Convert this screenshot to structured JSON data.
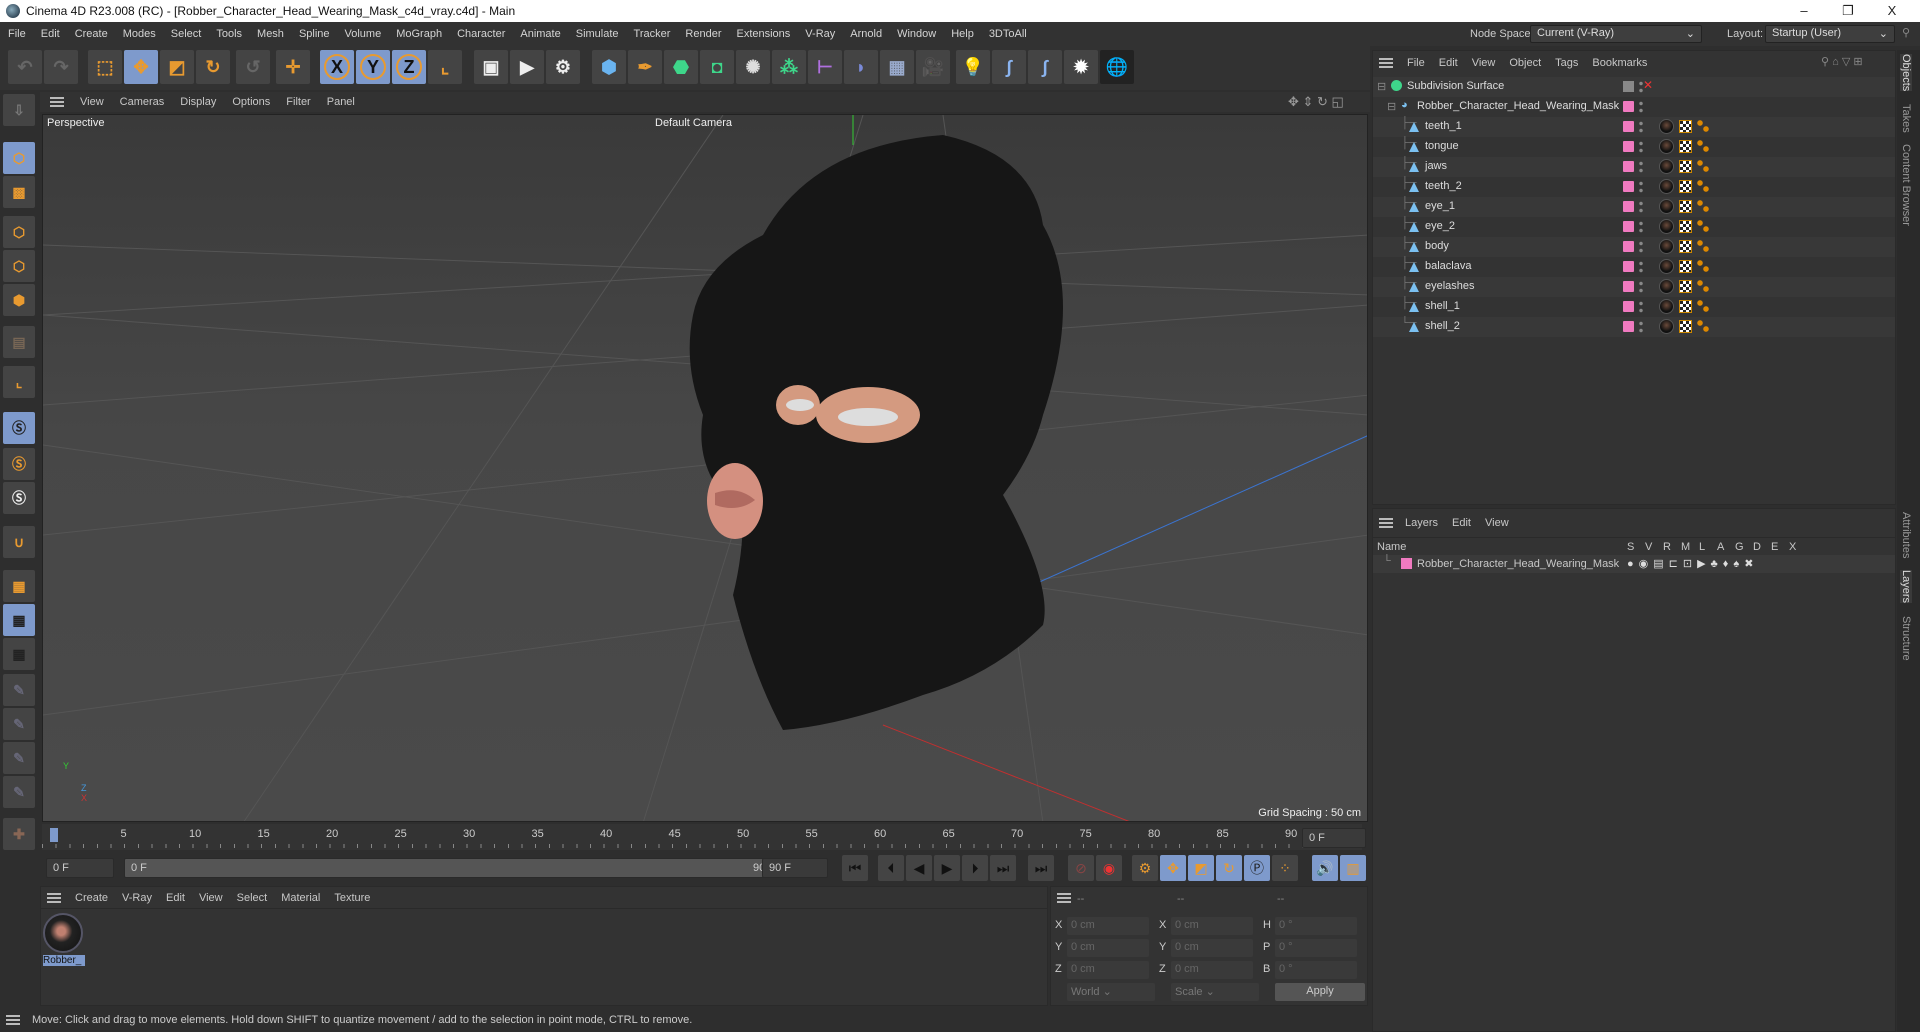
{
  "window": {
    "title": "Cinema 4D R23.008 (RC) - [Robber_Character_Head_Wearing_Mask_c4d_vray.c4d] - Main",
    "min": "–",
    "max": "❐",
    "close": "X"
  },
  "menu": [
    "File",
    "Edit",
    "Create",
    "Modes",
    "Select",
    "Tools",
    "Mesh",
    "Spline",
    "Volume",
    "MoGraph",
    "Character",
    "Animate",
    "Simulate",
    "Tracker",
    "Render",
    "Extensions",
    "V-Ray",
    "Arnold",
    "Window",
    "Help",
    "3DToAll"
  ],
  "nodespace": {
    "label": "Node Space:",
    "value": "Current (V-Ray)"
  },
  "layout": {
    "label": "Layout:",
    "value": "Startup (User)"
  },
  "toolbar": {
    "x": "X",
    "y": "Y",
    "z": "Z"
  },
  "viewport": {
    "menu": [
      "View",
      "Cameras",
      "Display",
      "Options",
      "Filter",
      "Panel"
    ],
    "name": "Perspective",
    "camera": "Default Camera",
    "grid": "Grid Spacing : 50 cm",
    "axis_y": "Y",
    "axis_z": "Z",
    "axis_x": "X"
  },
  "timeline": {
    "ticks": [
      "0",
      "5",
      "10",
      "15",
      "20",
      "25",
      "30",
      "35",
      "40",
      "45",
      "50",
      "55",
      "60",
      "65",
      "70",
      "75",
      "80",
      "85",
      "90"
    ],
    "current": "0 F",
    "start": "0 F",
    "range_start": "0 F",
    "range_end": "90 F",
    "end": "90 F"
  },
  "materials": {
    "menu": [
      "Create",
      "V-Ray",
      "Edit",
      "View",
      "Select",
      "Material",
      "Texture"
    ],
    "items": [
      {
        "name": "Robber_"
      }
    ]
  },
  "coords": {
    "headers": [
      "--",
      "--",
      "--"
    ],
    "labels": [
      "X",
      "Y",
      "Z",
      "X",
      "Y",
      "Z",
      "H",
      "P",
      "B"
    ],
    "values": [
      "0 cm",
      "0 cm",
      "0 cm",
      "0 cm",
      "0 cm",
      "0 cm",
      "0 °",
      "0 °",
      "0 °"
    ],
    "mode1": "World",
    "mode2": "Scale",
    "apply": "Apply"
  },
  "status": "Move: Click and drag to move elements. Hold down SHIFT to quantize movement / add to the selection in point mode, CTRL to remove.",
  "objects": {
    "menu": [
      "File",
      "Edit",
      "View",
      "Object",
      "Tags",
      "Bookmarks"
    ],
    "root": "Subdivision Surface",
    "group": "Robber_Character_Head_Wearing_Mask",
    "children": [
      "teeth_1",
      "tongue",
      "jaws",
      "teeth_2",
      "eye_1",
      "eye_2",
      "body",
      "balaclava",
      "eyelashes",
      "shell_1",
      "shell_2"
    ]
  },
  "layers": {
    "menu": [
      "Layers",
      "Edit",
      "View"
    ],
    "name_col": "Name",
    "cols": [
      "S",
      "V",
      "R",
      "M",
      "L",
      "A",
      "G",
      "D",
      "E",
      "X"
    ],
    "rows": [
      {
        "name": "Robber_Character_Head_Wearing_Mask",
        "color": "#f07ac0"
      }
    ]
  },
  "sidetabs": {
    "top": [
      "Objects",
      "Takes",
      "Content Browser"
    ],
    "bottom": [
      "Attributes",
      "Layers",
      "Structure"
    ]
  }
}
